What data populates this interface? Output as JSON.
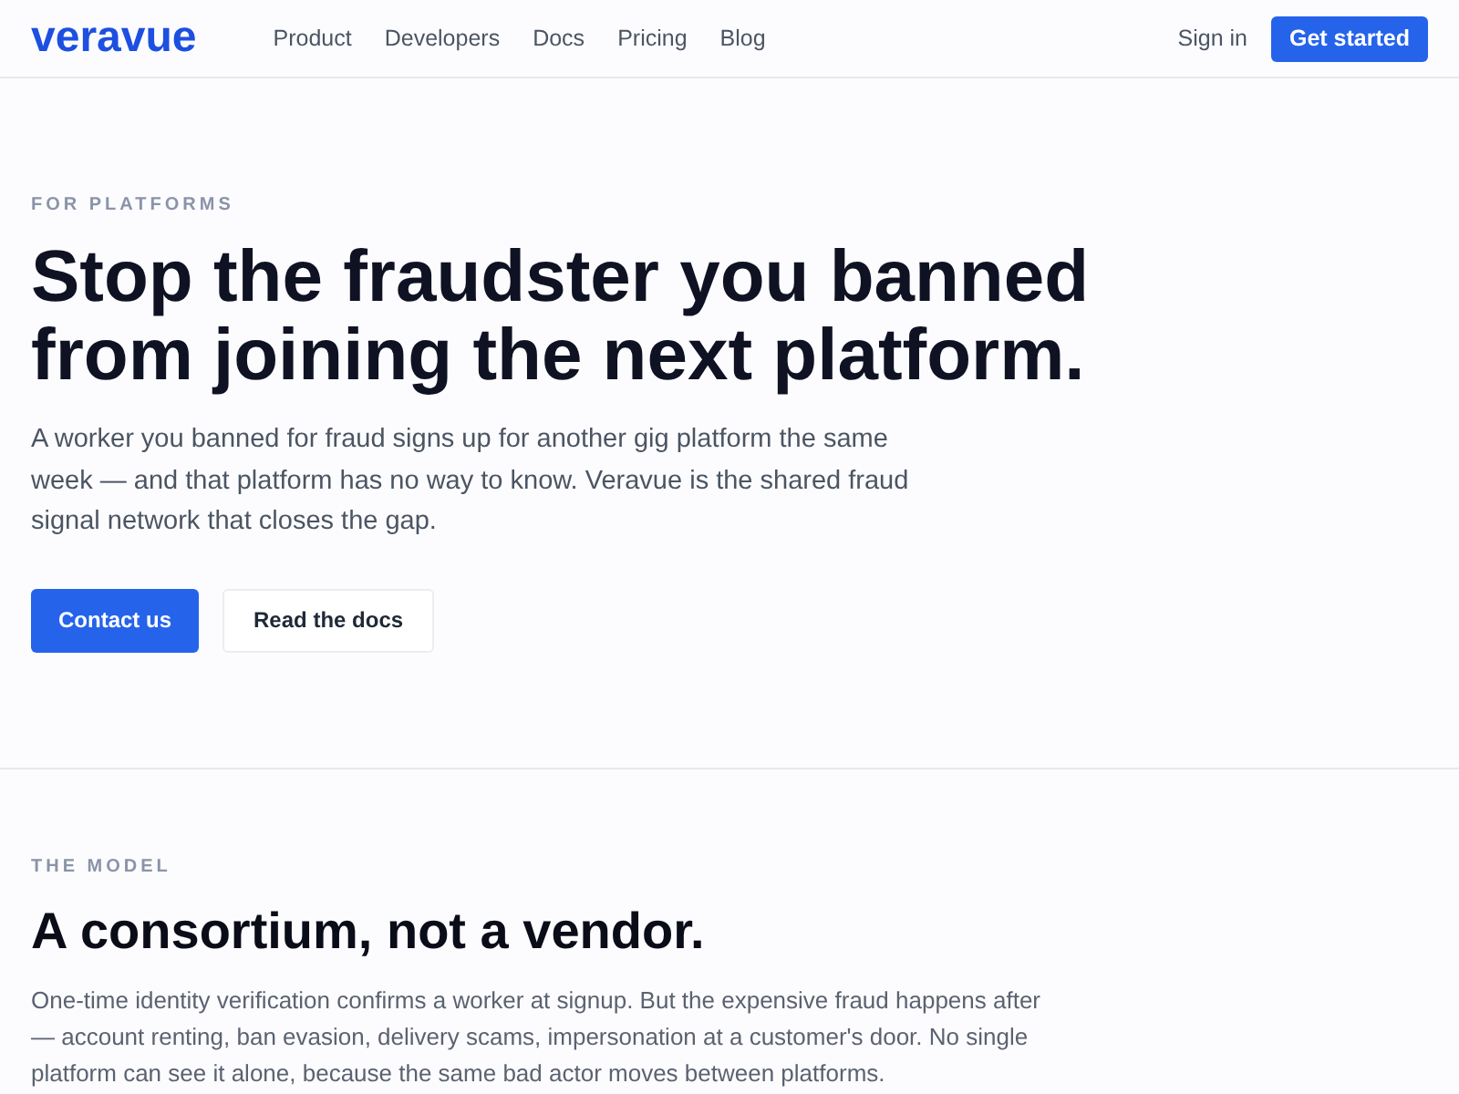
{
  "header": {
    "logo": "veravue",
    "nav": [
      "Product",
      "Developers",
      "Docs",
      "Pricing",
      "Blog"
    ],
    "sign_in": "Sign in",
    "cta": "Get started"
  },
  "hero": {
    "eyebrow": "FOR PLATFORMS",
    "title": "Stop the fraudster you banned from joining the next platform.",
    "description": "A worker you banned for fraud signs up for another gig platform the same week — and that platform has no way to know. Veravue is the shared fraud signal network that closes the gap.",
    "buttons": [
      {
        "label": "Contact us",
        "kind": "primary"
      },
      {
        "label": "Read the docs",
        "kind": "secondary"
      }
    ]
  },
  "model_section": {
    "eyebrow": "THE MODEL",
    "title": "A consortium, not a vendor.",
    "description": "One-time identity verification confirms a worker at signup. But the expensive fraud happens after — account renting, ban evasion, delivery scams, impersonation at a customer's door. No single platform can see it alone, because the same bad actor moves between platforms."
  }
}
